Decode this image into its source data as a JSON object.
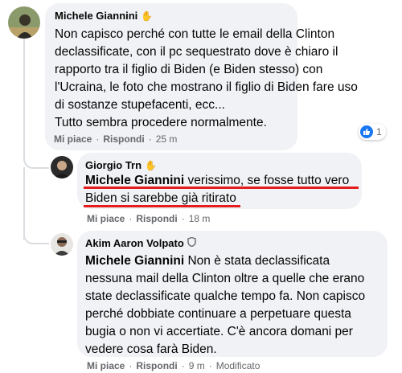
{
  "comment": {
    "author": "Michele Giannini",
    "author_icon": "wave-hand-icon",
    "lines": [
      "Non capisco perché con tutte le email della Clinton",
      "declassificate, con il pc sequestrato dove è chiaro il",
      "rapporto tra il figlio di Biden (e Biden stesso) con",
      "l'Ucraina, le foto che mostrano il figlio di Biden fare uso",
      "di sostanze stupefacenti, ecc...",
      "Tutto sembra procedere normalmente."
    ],
    "actions": {
      "like": "Mi piace",
      "sep": "·",
      "reply": "Rispondi",
      "time": "25 m"
    },
    "reactions": {
      "icon": "like-icon",
      "count": "1"
    }
  },
  "replies": [
    {
      "author": "Giorgio Trn",
      "author_icon": "wave-hand-icon",
      "mention": "Michele Giannini",
      "line1_rest": " verissimo, se fosse tutto vero",
      "line2": "Biden si sarebbe già ritirato",
      "actions": {
        "like": "Mi piace",
        "sep": "·",
        "reply": "Rispondi",
        "time": "18 m"
      }
    },
    {
      "author": "Akim Aaron Volpato",
      "author_icon": "shield-badge-icon",
      "mention": "Michele Giannini",
      "line1_rest": " Non è stata declassificata",
      "lines": [
        "nessuna mail della Clinton oltre a quelle che erano",
        "state declassificate qualche tempo fa. Non capisco",
        "perché dobbiate continuare a perpetuare questa",
        "bugia o non vi accertiate. C'è ancora domani per",
        "vedere cosa farà Biden."
      ],
      "actions": {
        "like": "Mi piace",
        "sep": "·",
        "reply": "Rispondi",
        "time": "9 m",
        "edited": "Modificato"
      }
    }
  ],
  "colors": {
    "bubble": "#f0f2f5",
    "secondary_text": "#65676b",
    "like_blue": "#1877f2",
    "annotation_red": "#e41e1e"
  }
}
